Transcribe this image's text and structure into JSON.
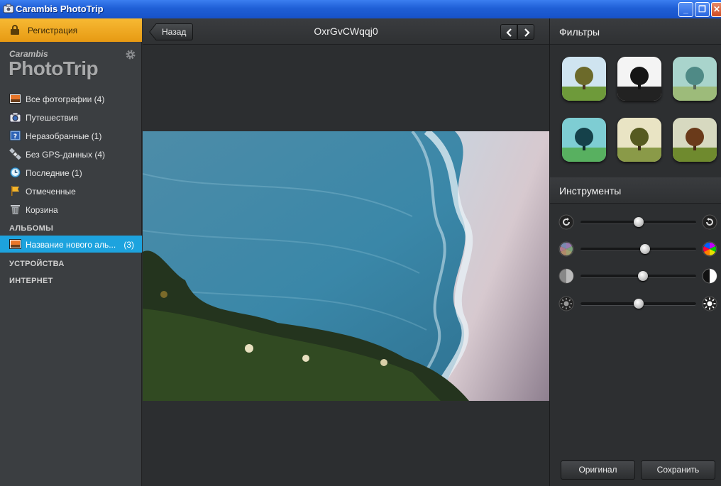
{
  "window": {
    "title": "Carambis PhotoTrip",
    "minimize": "_",
    "maximize": "❐",
    "close": "✕"
  },
  "sidebar": {
    "register_label": "Регистрация",
    "logo_small": "Carambis",
    "logo_big": "PhotoTrip",
    "items": [
      {
        "label": "Все фотографии (4)",
        "icon": "photos-icon"
      },
      {
        "label": "Путешествия",
        "icon": "camera-icon"
      },
      {
        "label": "Неразобранные (1)",
        "icon": "unsorted-icon"
      },
      {
        "label": "Без GPS-данных (4)",
        "icon": "satellite-icon"
      },
      {
        "label": "Последние (1)",
        "icon": "clock-icon"
      },
      {
        "label": "Отмеченные",
        "icon": "flag-icon"
      },
      {
        "label": "Корзина",
        "icon": "trash-icon"
      }
    ],
    "albums_header": "АЛЬБОМЫ",
    "album": {
      "label": "Название нового аль...",
      "count": "(3)"
    },
    "devices_header": "УСТРОЙСТВА",
    "internet_header": "ИНТЕРНЕТ"
  },
  "viewer": {
    "back_label": "Назад",
    "photo_title": "OxrGvCWqqj0"
  },
  "filters": {
    "header": "Фильтры"
  },
  "tools": {
    "header": "Инструменты",
    "sliders": [
      {
        "name": "rotate",
        "value": 0.5
      },
      {
        "name": "saturation",
        "value": 0.56
      },
      {
        "name": "contrast",
        "value": 0.54
      },
      {
        "name": "brightness",
        "value": 0.5
      }
    ]
  },
  "actions": {
    "original_label": "Оригинал",
    "save_label": "Сохранить"
  },
  "colors": {
    "accent": "#1da3de",
    "register": "#f0aa22",
    "titlebar": "#1f5fd6"
  }
}
